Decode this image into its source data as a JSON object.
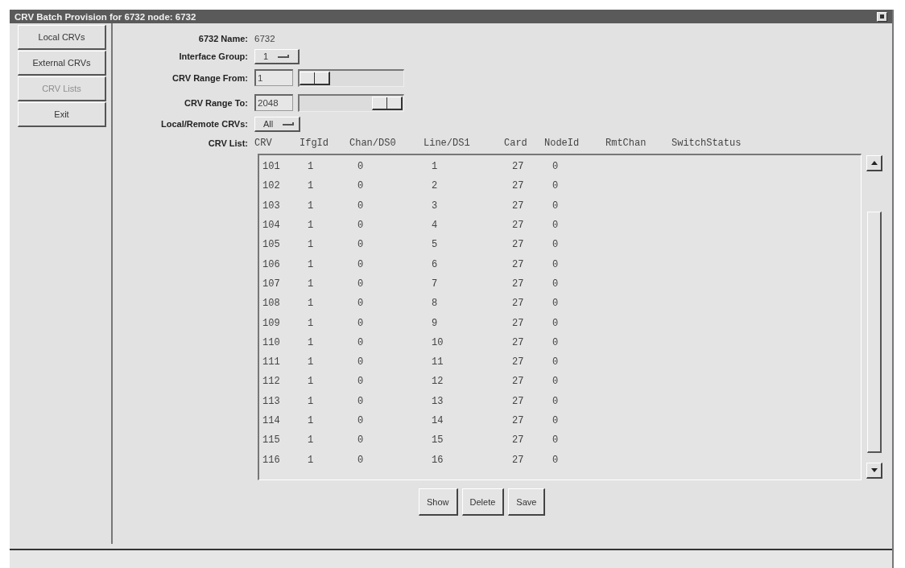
{
  "window": {
    "title": "CRV Batch Provision for 6732 node:   6732"
  },
  "sidebar": {
    "buttons": [
      {
        "label": "Local CRVs",
        "disabled": false
      },
      {
        "label": "External CRVs",
        "disabled": false
      },
      {
        "label": "CRV Lists",
        "disabled": true
      },
      {
        "label": "Exit",
        "disabled": false
      }
    ]
  },
  "form": {
    "name_label": "6732 Name:",
    "name_value": "6732",
    "interface_group": {
      "label": "Interface Group:",
      "value": "1"
    },
    "range_from": {
      "label": "CRV Range From:",
      "value": "1",
      "level": 0
    },
    "range_to": {
      "label": "CRV Range To:",
      "value": "2048",
      "level": 1
    },
    "local_remote": {
      "label": "Local/Remote CRVs:",
      "value": "All"
    },
    "list_label": "CRV List:"
  },
  "table": {
    "columns": [
      "CRV",
      "IfgId",
      "Chan/DS0",
      "Line/DS1",
      "Card",
      "NodeId",
      "RmtChan",
      "SwitchStatus"
    ],
    "rows": [
      [
        "101",
        "1",
        "0",
        "1",
        "27",
        "0"
      ],
      [
        "102",
        "1",
        "0",
        "2",
        "27",
        "0"
      ],
      [
        "103",
        "1",
        "0",
        "3",
        "27",
        "0"
      ],
      [
        "104",
        "1",
        "0",
        "4",
        "27",
        "0"
      ],
      [
        "105",
        "1",
        "0",
        "5",
        "27",
        "0"
      ],
      [
        "106",
        "1",
        "0",
        "6",
        "27",
        "0"
      ],
      [
        "107",
        "1",
        "0",
        "7",
        "27",
        "0"
      ],
      [
        "108",
        "1",
        "0",
        "8",
        "27",
        "0"
      ],
      [
        "109",
        "1",
        "0",
        "9",
        "27",
        "0"
      ],
      [
        "110",
        "1",
        "0",
        "10",
        "27",
        "0"
      ],
      [
        "111",
        "1",
        "0",
        "11",
        "27",
        "0"
      ],
      [
        "112",
        "1",
        "0",
        "12",
        "27",
        "0"
      ],
      [
        "113",
        "1",
        "0",
        "13",
        "27",
        "0"
      ],
      [
        "114",
        "1",
        "0",
        "14",
        "27",
        "0"
      ],
      [
        "115",
        "1",
        "0",
        "15",
        "27",
        "0"
      ],
      [
        "116",
        "1",
        "0",
        "16",
        "27",
        "0"
      ]
    ]
  },
  "actions": [
    "Show",
    "Delete",
    "Save"
  ]
}
